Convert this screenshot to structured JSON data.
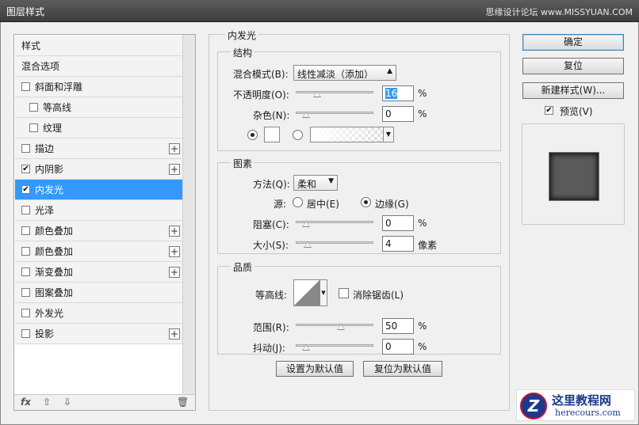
{
  "window": {
    "title": "图层样式",
    "watermark": "思缘设计论坛 www.MISSYUAN.COM"
  },
  "styles_list": {
    "items": [
      {
        "label": "样式",
        "checkbox": false,
        "checked": false,
        "plus": false,
        "indent": false,
        "selected": false
      },
      {
        "label": "混合选项",
        "checkbox": false,
        "checked": false,
        "plus": false,
        "indent": false,
        "selected": false
      },
      {
        "label": "斜面和浮雕",
        "checkbox": true,
        "checked": false,
        "plus": false,
        "indent": false,
        "selected": false
      },
      {
        "label": "等高线",
        "checkbox": true,
        "checked": false,
        "plus": false,
        "indent": true,
        "selected": false
      },
      {
        "label": "纹理",
        "checkbox": true,
        "checked": false,
        "plus": false,
        "indent": true,
        "selected": false
      },
      {
        "label": "描边",
        "checkbox": true,
        "checked": false,
        "plus": true,
        "indent": false,
        "selected": false
      },
      {
        "label": "内阴影",
        "checkbox": true,
        "checked": true,
        "plus": true,
        "indent": false,
        "selected": false
      },
      {
        "label": "内发光",
        "checkbox": true,
        "checked": true,
        "plus": false,
        "indent": false,
        "selected": true
      },
      {
        "label": "光泽",
        "checkbox": true,
        "checked": false,
        "plus": false,
        "indent": false,
        "selected": false
      },
      {
        "label": "颜色叠加",
        "checkbox": true,
        "checked": false,
        "plus": true,
        "indent": false,
        "selected": false
      },
      {
        "label": "颜色叠加",
        "checkbox": true,
        "checked": false,
        "plus": true,
        "indent": false,
        "selected": false
      },
      {
        "label": "渐变叠加",
        "checkbox": true,
        "checked": false,
        "plus": true,
        "indent": false,
        "selected": false
      },
      {
        "label": "图案叠加",
        "checkbox": true,
        "checked": false,
        "plus": false,
        "indent": false,
        "selected": false
      },
      {
        "label": "外发光",
        "checkbox": true,
        "checked": false,
        "plus": false,
        "indent": false,
        "selected": false
      },
      {
        "label": "投影",
        "checkbox": true,
        "checked": false,
        "plus": true,
        "indent": false,
        "selected": false
      }
    ],
    "bottom": {
      "fx": "fx",
      "up": "⇧",
      "down": "⇩",
      "trash": "🗑"
    }
  },
  "panel": {
    "title": "内发光",
    "structure": {
      "title": "结构",
      "blend_label": "混合模式(B):",
      "blend_value": "线性减淡（添加）",
      "opacity_label": "不透明度(O):",
      "opacity_value": "16",
      "opacity_fraction": 0.16,
      "noise_label": "杂色(N):",
      "noise_value": "0",
      "noise_fraction": 0.0,
      "percent": "%"
    },
    "elements": {
      "title": "图素",
      "method_label": "方法(Q):",
      "method_value": "柔和",
      "source_label": "源:",
      "center_label": "居中(E)",
      "edge_label": "边缘(G)",
      "choke_label": "阻塞(C):",
      "choke_value": "0",
      "choke_fraction": 0.0,
      "size_label": "大小(S):",
      "size_value": "4",
      "size_fraction": 0.02,
      "size_unit": "像素",
      "percent": "%"
    },
    "quality": {
      "title": "品质",
      "contour_label": "等高线:",
      "antialias_label": "消除锯齿(L)",
      "range_label": "范围(R):",
      "range_value": "50",
      "range_fraction": 0.5,
      "jitter_label": "抖动(J):",
      "jitter_value": "0",
      "jitter_fraction": 0.0,
      "percent": "%"
    },
    "make_default": "设置为默认值",
    "reset_default": "复位为默认值"
  },
  "actions": {
    "ok": "确定",
    "reset": "复位",
    "new_style": "新建样式(W)...",
    "preview_label": "预览(V)",
    "preview_checked": true
  },
  "logo": {
    "title": "这里教程网",
    "url": "herecours.com",
    "mark": "Z"
  },
  "colors": {
    "selection": "#3399ff",
    "title_bar": "#4a4a4a",
    "preview_fill": "#5a5a5a"
  }
}
